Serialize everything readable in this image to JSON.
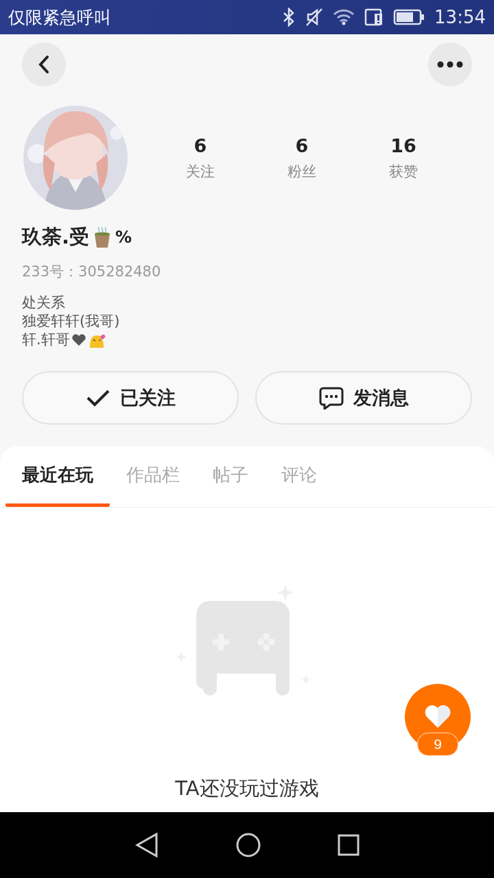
{
  "status_bar": {
    "carrier": "仅限紧急呼叫",
    "time": "13:54"
  },
  "header": {
    "avatar": {
      "kind": "picture"
    },
    "stats": [
      {
        "value": "6",
        "label": "关注"
      },
      {
        "value": "6",
        "label": "粉丝"
      },
      {
        "value": "16",
        "label": "获赞"
      }
    ],
    "name": "玖荼.受",
    "name_suffix": "%",
    "user_id": "233号：305282480",
    "bio": [
      "处关系",
      "独爱轩轩(我哥)",
      "轩.轩哥"
    ]
  },
  "actions": [
    {
      "kind": "follow",
      "label": "已关注"
    },
    {
      "kind": "message",
      "label": "发消息"
    }
  ],
  "tabs": [
    {
      "label": "最近在玩",
      "selected": true
    },
    {
      "label": "作品栏",
      "selected": false
    },
    {
      "label": "帖子",
      "selected": false
    },
    {
      "label": "评论",
      "selected": false
    }
  ],
  "empty_state": {
    "message": "TA还没玩过游戏"
  },
  "like_button": {
    "count": "9"
  }
}
